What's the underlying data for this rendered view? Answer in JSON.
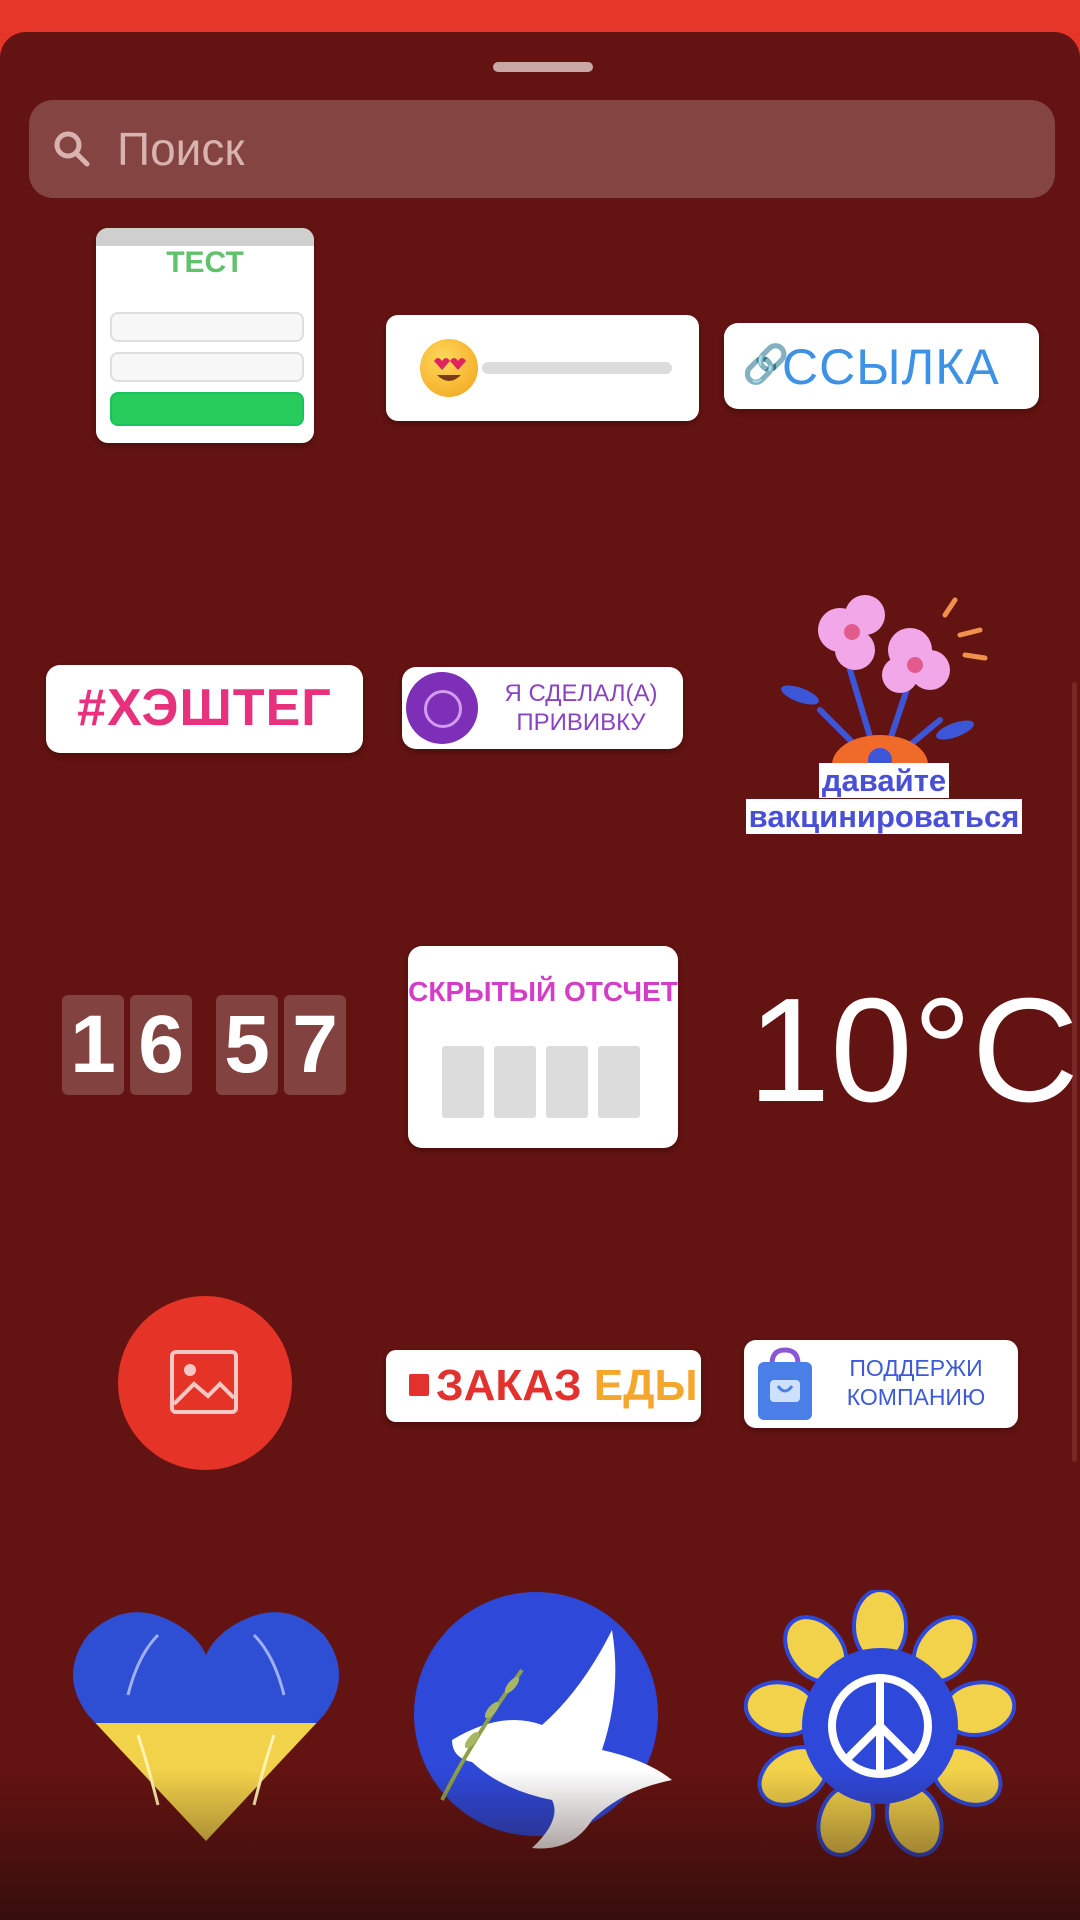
{
  "search": {
    "placeholder": "Поиск",
    "icon": "search-icon"
  },
  "colors": {
    "header": "#e63629",
    "sheet": "#631311",
    "search_bg": "#844441"
  },
  "stickers": {
    "quiz": {
      "title": "ТЕСТ"
    },
    "slider": {
      "emoji": "heart-eyes-emoji"
    },
    "link": {
      "label": "ССЫЛКА",
      "icon": "link-icon"
    },
    "hashtag": {
      "label": "#ХЭШТЕГ"
    },
    "challenge": {
      "label": "Я СДЕЛАЛ(А) ПРИВИВКУ"
    },
    "flowers": {
      "caption_line1": "давайте",
      "caption_line2": "вакцинироваться"
    },
    "countdown": {
      "d1": "1",
      "d2": "6",
      "d3": "5",
      "d4": "7"
    },
    "secret": {
      "title": "СКРЫТЫЙ ОТСЧЕТ"
    },
    "temperature": {
      "value": "10°C"
    },
    "photo": {
      "icon": "image-icon"
    },
    "food_order": {
      "part1": "ЗАКАЗ ",
      "part2": "ЕДЫ"
    },
    "support": {
      "label": "ПОДДЕРЖИ КОМПАНИЮ"
    },
    "heart": {
      "name": "ukraine-heart"
    },
    "dove": {
      "name": "peace-dove"
    },
    "sunflower": {
      "name": "peace-sunflower"
    }
  }
}
